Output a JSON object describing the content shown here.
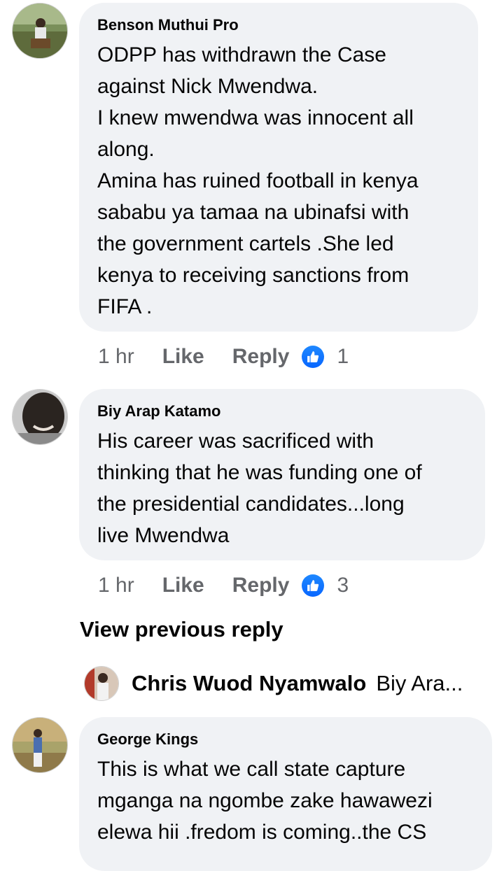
{
  "comments": [
    {
      "author": "Benson Muthui Pro",
      "lines": [
        "ODPP has withdrawn the Case",
        "against Nick Mwendwa.",
        "I knew mwendwa was innocent all",
        "along.",
        "Amina has ruined football in kenya",
        "sababu ya tamaa na ubinafsi with",
        "the government cartels .She led",
        "kenya to receiving sanctions from",
        "FIFA ."
      ],
      "time": "1 hr",
      "like_label": "Like",
      "reply_label": "Reply",
      "reaction_count": "1"
    },
    {
      "author": "Biy Arap Katamo",
      "lines": [
        "His career was sacrificed with",
        "thinking that he was funding one of",
        "the presidential candidates...long",
        "live Mwendwa"
      ],
      "time": "1 hr",
      "like_label": "Like",
      "reply_label": "Reply",
      "reaction_count": "3"
    },
    {
      "author": "George Kings",
      "lines": [
        "This is what we call state capture",
        "mganga na ngombe zake hawawezi",
        "elewa hii .fredom is coming..the CS"
      ]
    }
  ],
  "view_previous_reply": "View previous reply",
  "reply_preview": {
    "author": "Chris Wuod Nyamwalo",
    "snippet": "Biy Ara..."
  },
  "colors": {
    "bubble": "#f0f2f5",
    "meta_text": "#65676b",
    "like_blue": "#0866ff"
  },
  "icons": [
    "like-reaction-icon"
  ]
}
